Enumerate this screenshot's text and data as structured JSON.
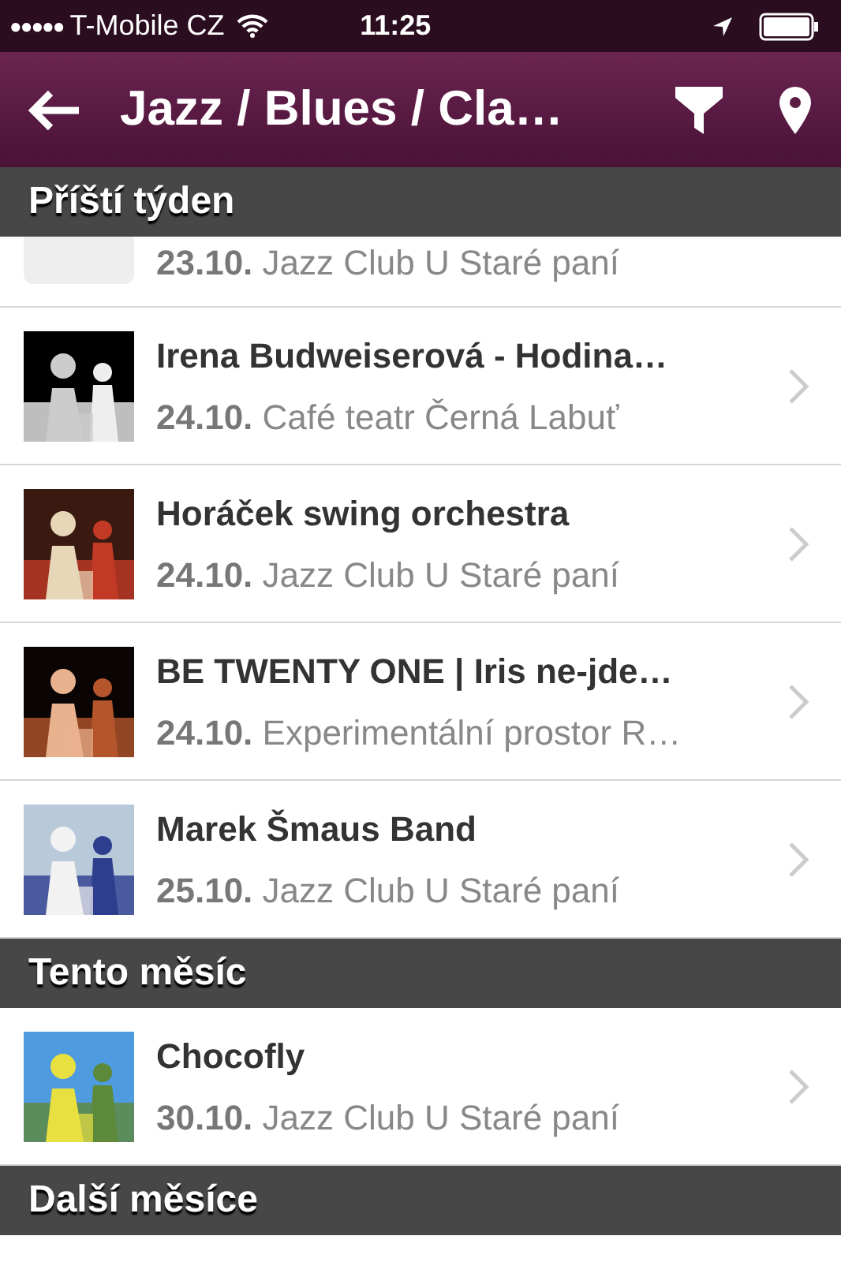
{
  "status_bar": {
    "signal_dots": "●●●●●",
    "carrier": "T-Mobile CZ",
    "time": "11:25"
  },
  "nav_bar": {
    "title": "Jazz / Blues / Cla…"
  },
  "sections": [
    {
      "title": "Příští týden",
      "events": [
        {
          "kind": "placeholder",
          "date": "23.10.",
          "venue": "Jazz Club U Staré paní"
        },
        {
          "title": "Irena Budweiserová - Hodina…",
          "date": "24.10.",
          "venue": "Café teatr Černá Labuť"
        },
        {
          "title": "Horáček swing orchestra",
          "date": "24.10.",
          "venue": "Jazz Club U Staré paní"
        },
        {
          "title": "BE TWENTY ONE | Iris ne-jde…",
          "date": "24.10.",
          "venue": "Experimentální prostor R…"
        },
        {
          "title": "Marek Šmaus Band",
          "date": "25.10.",
          "venue": "Jazz Club U Staré paní"
        }
      ]
    },
    {
      "title": "Tento měsíc",
      "events": [
        {
          "title": "Chocofly",
          "date": "30.10.",
          "venue": "Jazz Club U Staré paní"
        }
      ]
    },
    {
      "title": "Další měsíce"
    }
  ]
}
